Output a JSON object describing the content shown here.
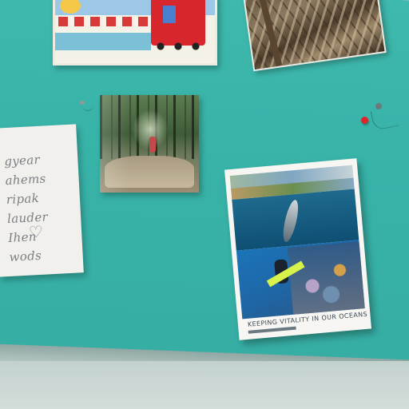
{
  "scene": {
    "board_color": "#3fb8ad",
    "floor_color": "#c9d6d3"
  },
  "note": {
    "lines": "gyear ahems\nripak\nlauder Ihen\nwods",
    "heart": "♡"
  },
  "poster": {
    "title": "KEEPING VITALITY IN OUR OCEANS"
  },
  "pins": [
    {
      "color": "#e0242b"
    },
    {
      "color": "#6d7a7a"
    },
    {
      "color": "#8e9a98"
    }
  ]
}
